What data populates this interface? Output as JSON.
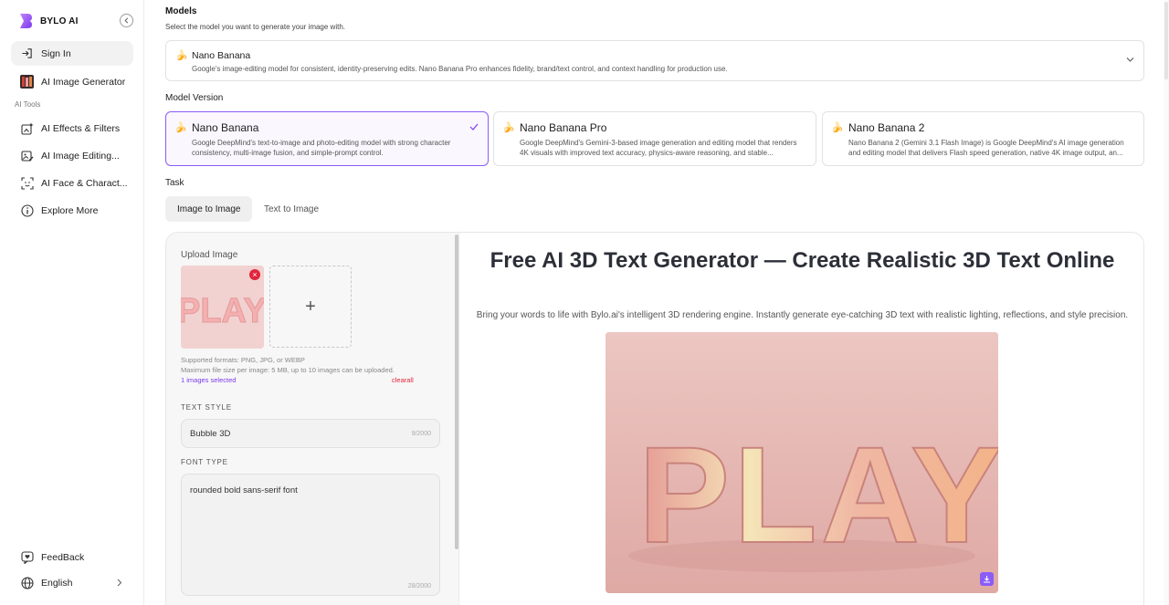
{
  "brand": {
    "name": "BYLO AI",
    "accent": "#8b5cf6"
  },
  "sidebar": {
    "sign_in": "Sign In",
    "image_generator": "AI Image Generator",
    "section_label": "AI Tools",
    "items": [
      {
        "label": "AI Effects & Filters",
        "icon": "sparkle-icon"
      },
      {
        "label": "AI Image Editing...",
        "icon": "image-edit-icon"
      },
      {
        "label": "AI Face & Charact...",
        "icon": "face-scan-icon"
      },
      {
        "label": "Explore More",
        "icon": "info-circle-icon"
      }
    ],
    "feedback": "FeedBack",
    "language": "English"
  },
  "models": {
    "heading": "Models",
    "subheading": "Select the model you want to generate your image with.",
    "selected": {
      "name": "Nano Banana",
      "description": "Google's image-editing model for consistent, identity-preserving edits. Nano Banana Pro enhances fidelity, brand/text control, and context handling for production use."
    }
  },
  "model_version": {
    "heading": "Model Version",
    "options": [
      {
        "name": "Nano Banana",
        "description": "Google DeepMind's text-to-image and photo-editing model with strong character consistency, multi-image fusion, and simple-prompt control.",
        "selected": true
      },
      {
        "name": "Nano Banana Pro",
        "description": "Google DeepMind's Gemini-3-based image generation and editing model that renders 4K visuals with improved text accuracy, physics-aware reasoning, and stable...",
        "selected": false
      },
      {
        "name": "Nano Banana 2",
        "description": "Nano Banana 2 (Gemini 3.1 Flash Image) is Google DeepMind's AI image generation and editing model that delivers Flash speed generation, native 4K image output, an...",
        "selected": false
      }
    ]
  },
  "task": {
    "heading": "Task",
    "tabs": [
      {
        "label": "Image to Image",
        "active": true
      },
      {
        "label": "Text to Image",
        "active": false
      }
    ]
  },
  "upload": {
    "label": "Upload Image",
    "thumb_text": "PLAY",
    "add_symbol": "+",
    "formats": "Supported formats: PNG, JPG, or WEBP",
    "limits": "Maximum file size per image: 5 MB, up to 10 images can be uploaded.",
    "selected_count": "1 images selected",
    "clear_all": "clearall"
  },
  "text_style": {
    "label": "TEXT STYLE",
    "value": "Bubble 3D",
    "counter": "9/2000"
  },
  "font_type": {
    "label": "FONT TYPE",
    "value": "rounded bold sans-serif font",
    "counter": "28/2000"
  },
  "hero": {
    "title": "Free AI 3D Text Generator — Create Realistic 3D Text Online",
    "subtitle": "Bring your words to life with Bylo.ai's intelligent 3D rendering engine. Instantly generate eye-catching 3D text with realistic lighting, reflections, and style precision.",
    "image_text": "PLAY"
  }
}
